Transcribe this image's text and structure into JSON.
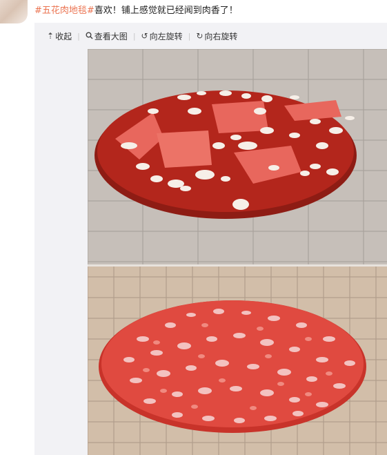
{
  "post": {
    "hashtag": "#五花肉地毯#",
    "text": "喜欢！铺上感觉就已经闻到肉香了！"
  },
  "toolbar": {
    "collapse": {
      "label": "收起",
      "icon": "arrow-up-icon"
    },
    "view_large": {
      "label": "查看大图",
      "icon": "search-icon"
    },
    "rotate_left": {
      "label": "向左旋转",
      "icon": "rotate-left-icon"
    },
    "rotate_right": {
      "label": "向右旋转",
      "icon": "rotate-right-icon"
    }
  },
  "colors": {
    "hashtag": "#eb7350",
    "rug_dark_red": "#b3261c",
    "rug_red": "#e04a40",
    "rug_pink": "#f08a80",
    "floor_gray": "#bfb8b2",
    "floor_beige": "#cdb8a3"
  }
}
